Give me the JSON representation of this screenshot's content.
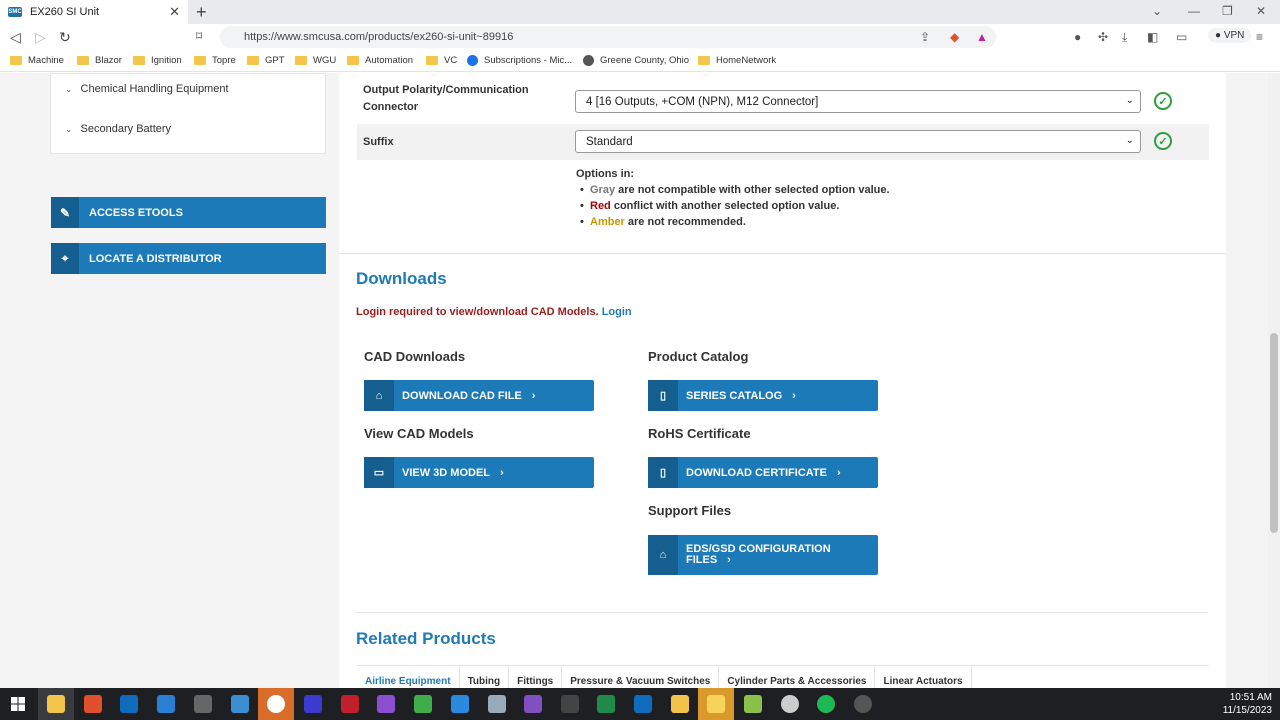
{
  "browser": {
    "tab_title": "EX260 SI Unit",
    "favicon_text": "SMC",
    "url": "https://www.smcusa.com/products/ex260-si-unit~89916",
    "vpn_label": "VPN",
    "bookmarks": [
      "Machine",
      "Blazor",
      "Ignition",
      "Topre",
      "GPT",
      "WGU",
      "Automation",
      "VC",
      "Subscriptions - Mic...",
      "Greene County, Ohio",
      "HomeNetwork"
    ]
  },
  "sidebar": {
    "items": [
      {
        "label": "Chemical Handling Equipment"
      },
      {
        "label": "Secondary Battery"
      }
    ],
    "access_etools": "ACCESS ETOOLS",
    "locate_distributor": "LOCATE A DISTRIBUTOR"
  },
  "options": {
    "rows": [
      {
        "label": "Output Polarity/Communication Connector",
        "value": "4 [16 Outputs, +COM (NPN), M12 Connector]"
      },
      {
        "label": "Suffix",
        "value": "Standard"
      }
    ],
    "legend_head": "Options in:",
    "legend": [
      {
        "key": "Gray",
        "text": " are not compatible with other selected option value.",
        "color": "#777777"
      },
      {
        "key": "Red",
        "text": " conflict with another selected option value.",
        "color": "#b00000"
      },
      {
        "key": "Amber",
        "text": " are not recommended.",
        "color": "#c49a00"
      }
    ]
  },
  "downloads": {
    "title": "Downloads",
    "login_note": "Login required to view/download CAD Models.",
    "login_link": "Login",
    "cad_downloads": "CAD Downloads",
    "download_cad": "DOWNLOAD CAD FILE",
    "view_cad": "View CAD Models",
    "view_3d": "VIEW 3D MODEL",
    "product_catalog": "Product Catalog",
    "series_catalog": "SERIES CATALOG",
    "rohs": "RoHS Certificate",
    "download_cert": "DOWNLOAD CERTIFICATE",
    "support_files": "Support Files",
    "eds_line1": "EDS/GSD CONFIGURATION",
    "eds_line2": "FILES"
  },
  "related": {
    "title": "Related Products",
    "tabs": [
      "Airline Equipment",
      "Tubing",
      "Fittings",
      "Pressure & Vacuum Switches",
      "Cylinder Parts & Accessories",
      "Linear Actuators"
    ]
  },
  "taskbar": {
    "time": "10:51 AM",
    "date": "11/15/2023"
  },
  "colors": {
    "primary": "#1d7ab8",
    "primary_dark": "#155f90",
    "heading": "#1f7ab5",
    "check": "#2e9e3e",
    "error": "#9b1c1c"
  }
}
